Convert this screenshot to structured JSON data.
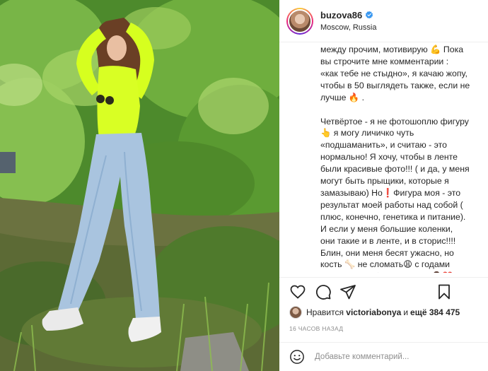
{
  "post": {
    "username": "buzova86",
    "location": "Moscow, Russia",
    "caption_lines_1": [
      "между прочим, мотивирую 💪 Пока",
      "вы строчите мне комментарии :",
      "«как тебе не стыдно», я качаю жопу,",
      "чтобы в 50 выглядеть также, если не",
      "лучше 🔥 ."
    ],
    "caption_lines_2": [
      "Четвёртое - я не фотошоплю фигуру",
      "👆 я могу личичко чуть",
      "«подшаманить», и считаю - это",
      "нормально! Я хочу, чтобы в ленте",
      "были красивые фото!!! ( и да, у меня",
      "могут быть прыщики, которые я",
      "замазываю) Но❗Фигура моя - это",
      "результат моей работы над собой (",
      "плюс, конечно, генетика и питание).",
      "И если у меня большие коленки,",
      "они такие и в ленте, и в сторис!!!!",
      "Блин, они меня бесят ужасно, но",
      "кость 🦴 не сломать😩 с годами",
      "научилась себя принимать 🤷‍♀️❤️."
    ],
    "likes": {
      "prefix": "Нравится",
      "user": "victoriabonya",
      "connector": "и",
      "count": "ещё 384 475"
    },
    "time_ago": "16 часов назад",
    "comment_placeholder": "Добавьте комментарий..."
  },
  "icons": {
    "like": "heart-icon",
    "comment": "comment-icon",
    "share": "share-icon",
    "save": "bookmark-icon",
    "emoji": "smile-icon",
    "verified": "verified-icon"
  },
  "colors": {
    "text": "#262626",
    "muted": "#8e8e8e",
    "verified": "#3897f0",
    "border": "#efefef"
  }
}
